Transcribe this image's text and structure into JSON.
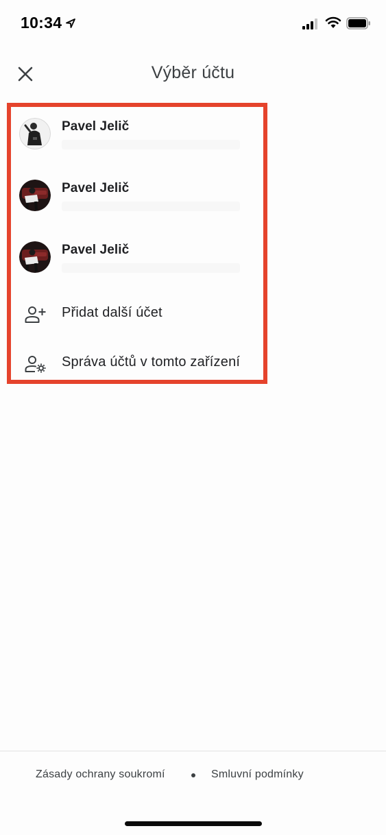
{
  "status_bar": {
    "time": "10:34",
    "icons": [
      "location-arrow-icon",
      "cellular-signal-icon",
      "wifi-icon",
      "battery-icon"
    ]
  },
  "header": {
    "close_icon": "close-icon",
    "title": "Výběr účtu"
  },
  "highlight_color": "#e5432c",
  "accounts": [
    {
      "name": "Pavel Jelič",
      "avatar": "profile-photo"
    },
    {
      "name": "Pavel Jelič",
      "avatar": "profile-photo"
    },
    {
      "name": "Pavel Jelič",
      "avatar": "profile-photo"
    }
  ],
  "actions": [
    {
      "label": "Přidat další účet",
      "icon": "add-person-icon"
    },
    {
      "label": "Správa účtů v tomto zařízení",
      "icon": "manage-accounts-icon"
    }
  ],
  "footer": {
    "privacy_label": "Zásady ochrany soukromí",
    "terms_label": "Smluvní podmínky"
  }
}
